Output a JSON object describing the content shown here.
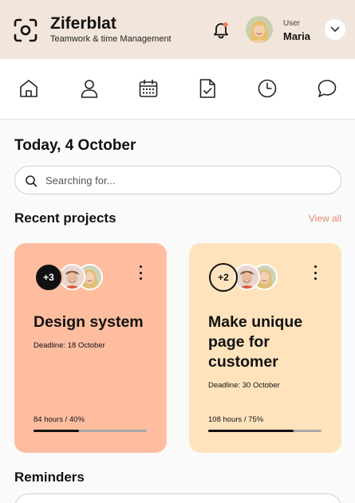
{
  "app": {
    "name": "Ziferblat",
    "tagline": "Teamwork & time Management"
  },
  "user": {
    "role": "User",
    "name": "Maria"
  },
  "nav": {
    "items": [
      {
        "icon": "home-icon"
      },
      {
        "icon": "user-icon"
      },
      {
        "icon": "calendar-icon"
      },
      {
        "icon": "document-check-icon"
      },
      {
        "icon": "clock-icon"
      },
      {
        "icon": "chat-icon"
      }
    ]
  },
  "main": {
    "date_title": "Today, 4 October",
    "search_placeholder": "Searching for...",
    "recent_title": "Recent projects",
    "view_all": "View all",
    "reminders_title": "Reminders"
  },
  "projects": [
    {
      "count": "+3",
      "title": "Design system",
      "deadline": "Deadline: 18 October",
      "hours": "84 hours / 40%",
      "progress": 0.4,
      "color": "#ffbda0"
    },
    {
      "count": "+2",
      "title": "Make unique page for customer",
      "deadline": "Deadline: 30 October",
      "hours": "108 hours / 75%",
      "progress": 0.75,
      "color": "#ffe3bc"
    }
  ],
  "colors": {
    "header_bg": "#f2e6dc",
    "accent": "#e08a6e",
    "notification_dot": "#f07a54"
  }
}
